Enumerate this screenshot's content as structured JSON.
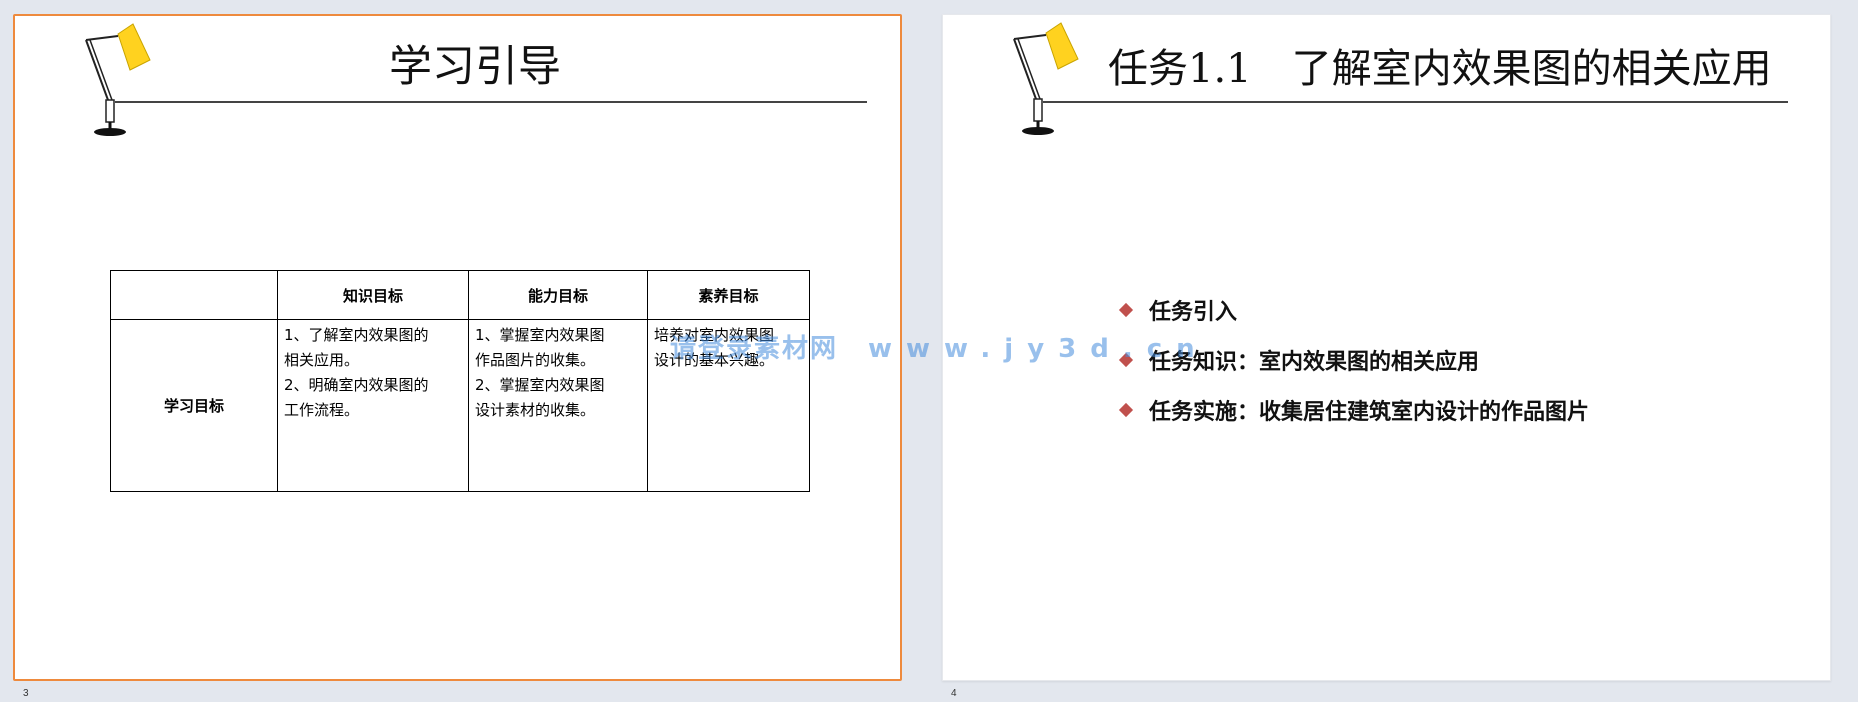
{
  "slides": [
    {
      "number": "3",
      "title": "学习引导",
      "table": {
        "headers": [
          "",
          "知识目标",
          "能力目标",
          "素养目标"
        ],
        "row_label": "学习目标",
        "cells": [
          [
            "1、了解室内效果图的",
            "相关应用。",
            "2、明确室内效果图的",
            "工作流程。"
          ],
          [
            "1、掌握室内效果图",
            "作品图片的收集。",
            "2、掌握室内效果图",
            "设计素材的收集。"
          ],
          [
            "培养对室内效果图",
            "设计的基本兴趣。"
          ]
        ]
      }
    },
    {
      "number": "4",
      "title": "任务1.1　了解室内效果图的相关应用",
      "bullets": [
        "任务引入",
        "任务知识：室内效果图的相关应用",
        "任务实施：收集居住建筑室内设计的作品图片"
      ]
    }
  ],
  "watermark": {
    "site_name": "请登录素材网",
    "url": "www.jy3d.cn"
  },
  "colors": {
    "selected_slide_border": "#ee8a3d",
    "bullet_diamond": "#c0504d",
    "lamp_shade": "#ffd21f",
    "background": "#e3e7ee"
  }
}
